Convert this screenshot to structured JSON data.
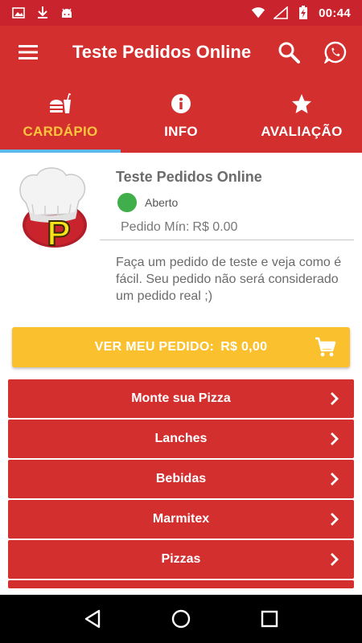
{
  "status_bar": {
    "time": "00:44",
    "left_icons": [
      "image-icon",
      "download-icon",
      "android-icon"
    ],
    "right_icons": [
      "wifi-icon",
      "signal-icon",
      "battery-charging-icon"
    ]
  },
  "app_bar": {
    "title": "Teste Pedidos Online",
    "menu_icon": "hamburger-menu-icon",
    "actions": [
      "search-icon",
      "whatsapp-icon"
    ]
  },
  "tabs": [
    {
      "label": "CARDÁPIO",
      "icon": "food-drink-icon",
      "active": true
    },
    {
      "label": "INFO",
      "icon": "info-icon",
      "active": false
    },
    {
      "label": "AVALIAÇÃO",
      "icon": "star-icon",
      "active": false
    }
  ],
  "restaurant": {
    "name": "Teste Pedidos Online",
    "status": "Aberto",
    "status_color": "#3fae4b",
    "min_order_label": "Pedido Mín:",
    "min_order_value": "R$ 0.00",
    "description": "Faça um pedido de teste e veja como é fácil.  Seu pedido não será considerado um pedido real ;)",
    "logo_letter": "P"
  },
  "order_button": {
    "label": "VER MEU PEDIDO:",
    "amount": "R$ 0,00",
    "icon": "cart-icon"
  },
  "menu_categories": [
    {
      "label": "Monte sua Pizza"
    },
    {
      "label": "Lanches"
    },
    {
      "label": "Bebidas"
    },
    {
      "label": "Marmitex"
    },
    {
      "label": "Pizzas"
    }
  ],
  "colors": {
    "primary": "#d32f2f",
    "status_bar": "#c9242d",
    "accent": "#fbc02d",
    "tab_active": "#ffc53d",
    "tab_indicator": "#5bb8e8"
  },
  "nav_bar": [
    "back-icon",
    "home-icon",
    "recents-icon"
  ]
}
